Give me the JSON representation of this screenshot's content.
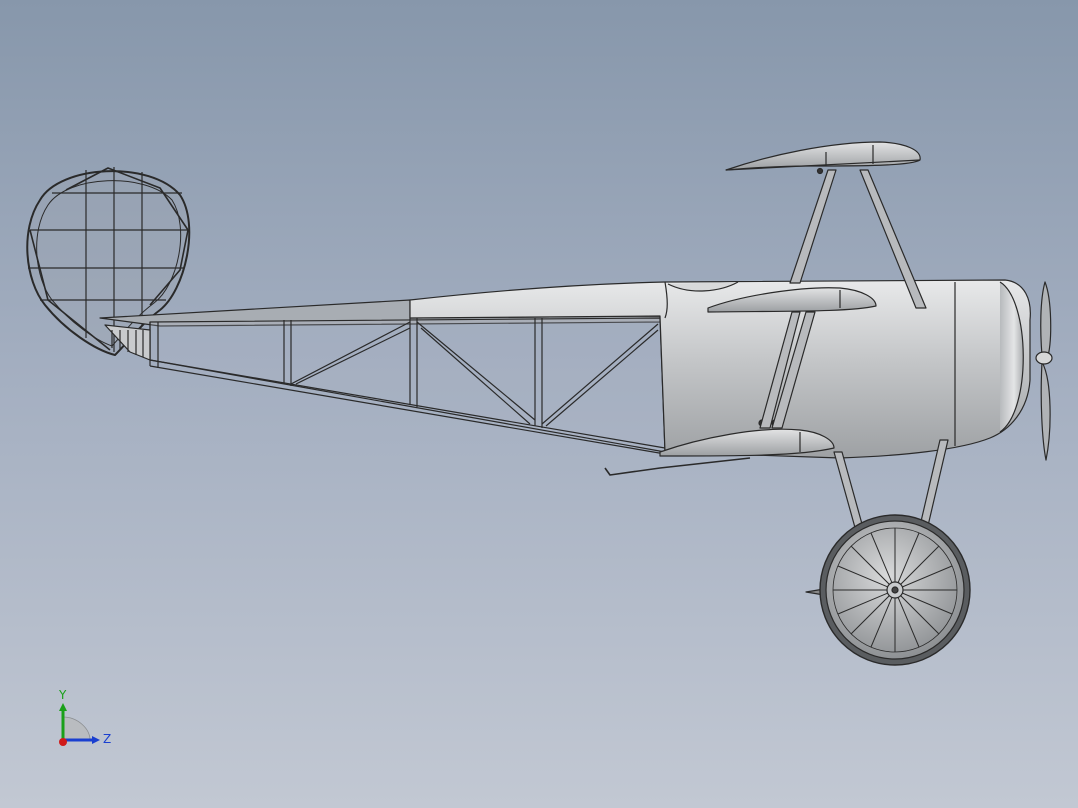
{
  "viewport": {
    "model": "triplane",
    "view": "side"
  },
  "triad": {
    "y_label": "Y",
    "z_label": "Z",
    "colors": {
      "y": "#1aa01a",
      "z": "#1a3fd0",
      "x": "#d01a1a"
    }
  },
  "colors": {
    "background_top": "#8797ab",
    "background_bottom": "#c2c8d3",
    "body": "#c9cbcd",
    "line": "#2a2a2a"
  }
}
